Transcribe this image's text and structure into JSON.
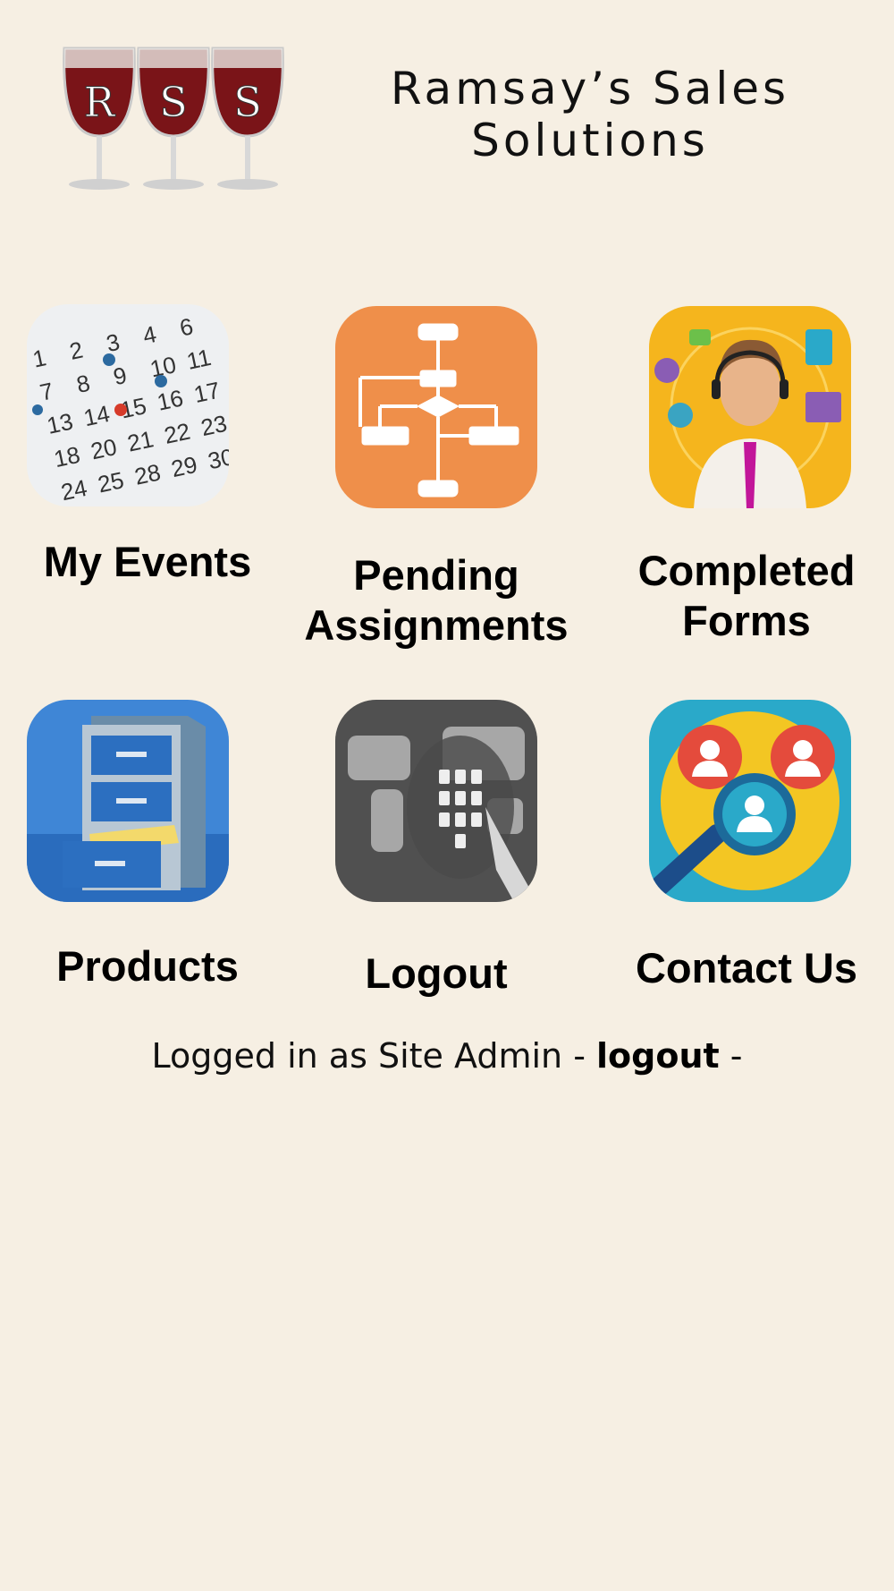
{
  "brand": {
    "logo_letters": [
      "R",
      "S",
      "S"
    ],
    "name_line1": "Ramsay’s Sales",
    "name_line2": "Solutions"
  },
  "tiles": [
    {
      "label": "My Events",
      "icon": "calendar-icon"
    },
    {
      "label_line1": "Pending",
      "label_line2": "Assignments",
      "icon": "flowchart-icon"
    },
    {
      "label_line1": "Completed",
      "label_line2": "Forms",
      "icon": "support-agent-icon"
    },
    {
      "label": "Products",
      "icon": "filing-cabinet-icon"
    },
    {
      "label": "Logout",
      "icon": "keypad-globe-icon"
    },
    {
      "label": "Contact Us",
      "icon": "contacts-search-icon"
    }
  ],
  "calendar_numbers": [
    "1",
    "2",
    "3",
    "4",
    "6",
    "7",
    "8",
    "9",
    "10",
    "11",
    "13",
    "14",
    "15",
    "16",
    "17",
    "18",
    "20",
    "21",
    "22",
    "23",
    "24",
    "25",
    "28",
    "29",
    "30"
  ],
  "footer": {
    "prefix": "Logged in as Site Admin -",
    "logout_link": "logout",
    "suffix": "-"
  },
  "colors": {
    "background": "#f6efe3",
    "wine": "#7a1418",
    "flowchart_orange": "#ef8f4a",
    "contact_teal": "#2aa9c9",
    "contact_yellow": "#f3c623",
    "contact_red": "#e44b3c"
  }
}
